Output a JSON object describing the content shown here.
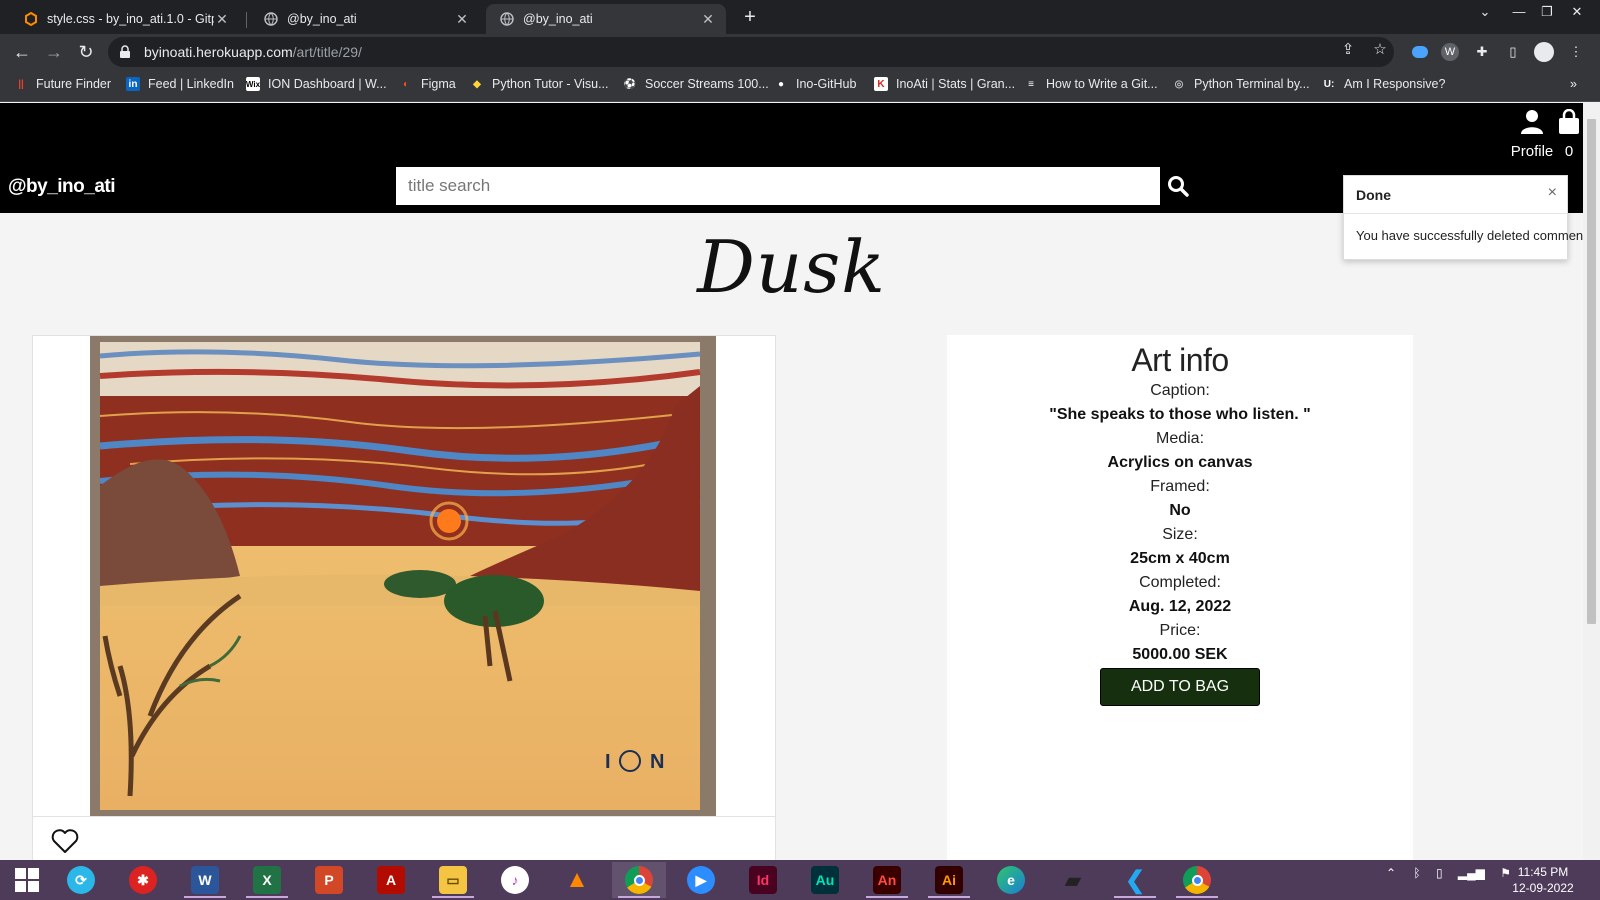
{
  "browser": {
    "tabs": [
      {
        "title": "style.css - by_ino_ati.1.0 - Gitpod",
        "favicon": "gitpod-icon"
      },
      {
        "title": "@by_ino_ati",
        "favicon": "globe-icon"
      },
      {
        "title": "@by_ino_ati",
        "favicon": "globe-icon",
        "active": true
      }
    ],
    "url_host": "byinoati.herokuapp.com",
    "url_path": "/art/title/29/",
    "bookmarks": [
      {
        "label": "Future Finder"
      },
      {
        "label": "Feed | LinkedIn"
      },
      {
        "label": "ION Dashboard | W..."
      },
      {
        "label": "Figma"
      },
      {
        "label": "Python Tutor - Visu..."
      },
      {
        "label": "Soccer Streams 100..."
      },
      {
        "label": "Ino-GitHub"
      },
      {
        "label": "InoAti | Stats | Gran..."
      },
      {
        "label": "How to Write a Git..."
      },
      {
        "label": "Python Terminal by..."
      },
      {
        "label": "Am I Responsive?"
      }
    ],
    "overflow": "»"
  },
  "site": {
    "brand": "@by_ino_ati",
    "search_placeholder": "title search",
    "profile_label": "Profile",
    "bag_count": "0",
    "nav_clipped": "il"
  },
  "artwork": {
    "title": "Dusk",
    "info_heading": "Art info",
    "caption_label": "Caption:",
    "caption": "\"She speaks to those who listen. \"",
    "media_label": "Media:",
    "media": "Acrylics on canvas",
    "framed_label": "Framed:",
    "framed": "No",
    "size_label": "Size:",
    "size": "25cm x 40cm",
    "completed_label": "Completed:",
    "completed": "Aug. 12, 2022",
    "price_label": "Price:",
    "price": "5000.00 SEK",
    "add_to_bag": "ADD TO BAG"
  },
  "toast": {
    "title": "Done",
    "close": "×",
    "message": "You have successfully deleted comment"
  },
  "taskbar": {
    "time": "11:45 PM",
    "date": "12-09-2022"
  }
}
